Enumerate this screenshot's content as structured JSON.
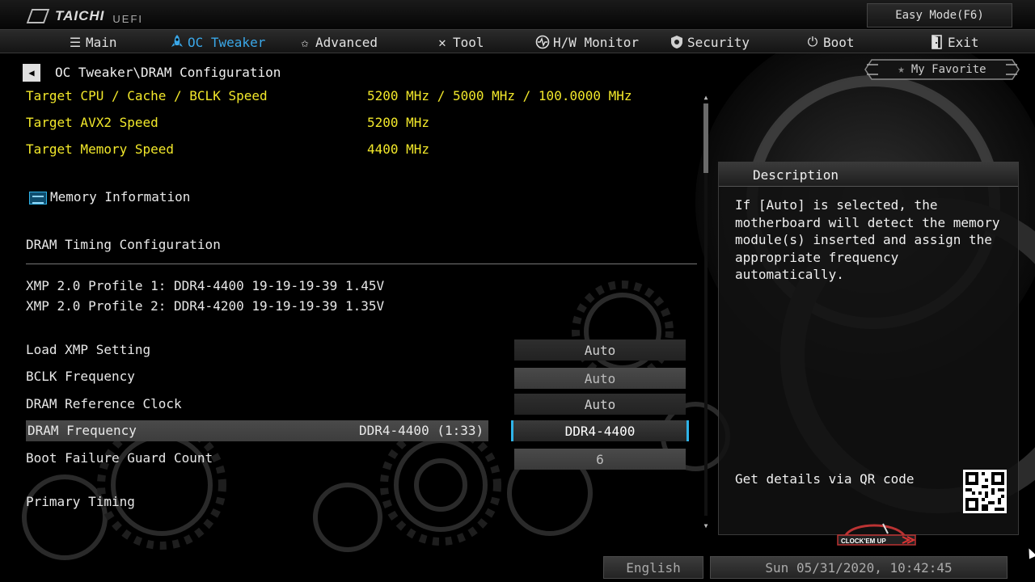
{
  "brand": {
    "name": "TAICHI",
    "sub": "UEFI"
  },
  "easy_mode_label": "Easy Mode(F6)",
  "nav": [
    {
      "label": "Main",
      "icon": "list-icon",
      "active": false
    },
    {
      "label": "OC Tweaker",
      "icon": "rocket-icon",
      "active": true
    },
    {
      "label": "Advanced",
      "icon": "star-icon",
      "active": false
    },
    {
      "label": "Tool",
      "icon": "tools-icon",
      "active": false
    },
    {
      "label": "H/W Monitor",
      "icon": "monitor-icon",
      "active": false
    },
    {
      "label": "Security",
      "icon": "shield-icon",
      "active": false
    },
    {
      "label": "Boot",
      "icon": "power-icon",
      "active": false
    },
    {
      "label": "Exit",
      "icon": "exit-icon",
      "active": false
    }
  ],
  "breadcrumb": "OC Tweaker\\DRAM Configuration",
  "favorite_label": "My Favorite",
  "targets": [
    {
      "label": "Target CPU / Cache / BCLK Speed",
      "value": "5200 MHz / 5000 MHz / 100.0000 MHz"
    },
    {
      "label": "Target AVX2 Speed",
      "value": "5200 MHz"
    },
    {
      "label": "Target Memory Speed",
      "value": "4400 MHz"
    }
  ],
  "memory_information_label": "Memory Information",
  "dram_timing_label": "DRAM Timing Configuration",
  "xmp_profiles": [
    "XMP 2.0 Profile 1: DDR4-4400 19-19-19-39 1.45V",
    "XMP 2.0 Profile 2: DDR4-4200 19-19-19-39 1.35V"
  ],
  "settings": [
    {
      "label": "Load XMP Setting",
      "current": "",
      "value": "Auto"
    },
    {
      "label": "BCLK Frequency",
      "current": "",
      "value": "Auto"
    },
    {
      "label": "DRAM Reference Clock",
      "current": "",
      "value": "Auto"
    },
    {
      "label": "DRAM Frequency",
      "current": "DDR4-4400 (1:33)",
      "value": "DDR4-4400"
    },
    {
      "label": "Boot Failure Guard Count",
      "current": "",
      "value": "6"
    }
  ],
  "primary_timing_label": "Primary Timing",
  "description": {
    "title": "Description",
    "text": "If [Auto] is selected, the motherboard will detect the memory module(s) inserted and assign the appropriate frequency automatically.",
    "qr_text": "Get details via QR code"
  },
  "oc_logo_text": "CLOCK'EM UP",
  "language": "English",
  "datetime": "Sun 05/31/2020, 10:42:45"
}
